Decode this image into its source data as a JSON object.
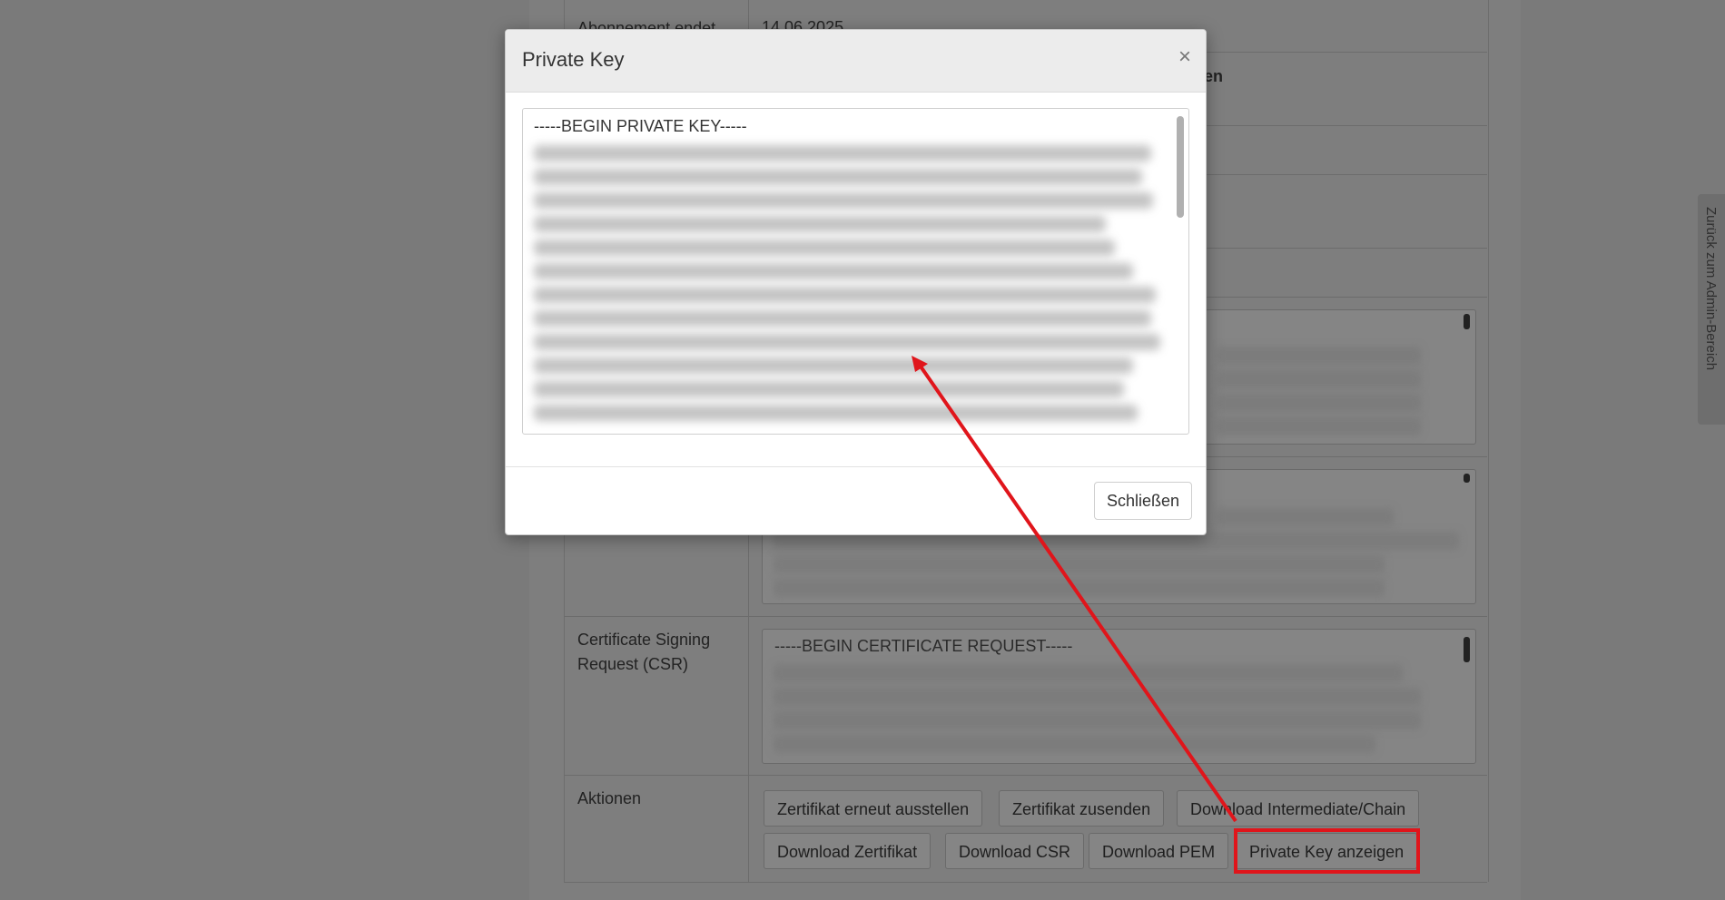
{
  "background_page": {
    "rows": [
      {
        "label": "Abonnement endet",
        "value": "14.06.2025"
      },
      {
        "value_partial": "en"
      },
      {
        "label": "Certificate Signing Request (CSR)",
        "textarea_first_line": "-----BEGIN CERTIFICATE REQUEST-----"
      },
      {
        "label": "Aktionen"
      }
    ],
    "actions": [
      "Zertifikat erneut ausstellen",
      "Zertifikat zusenden",
      "Download Intermediate/Chain",
      "Download Zertifikat",
      "Download CSR",
      "Download PEM",
      "Private Key anzeigen"
    ],
    "side_tab": "Zurück zum Admin-Bereich"
  },
  "modal": {
    "title": "Private Key",
    "close_symbol": "×",
    "key_first_line": "-----BEGIN PRIVATE KEY-----",
    "close_button": "Schließen"
  },
  "annotation": {
    "arrow_color": "#e0151b",
    "highlight_color": "#e0151b"
  },
  "icons": {
    "side_tab_icon": "refresh-icon"
  }
}
